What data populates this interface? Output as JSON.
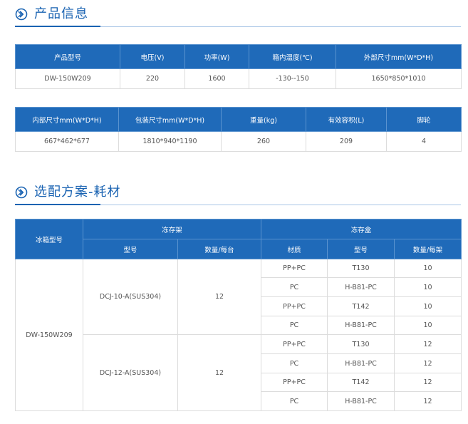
{
  "section1": {
    "title": "产品信息",
    "icon": "chevron-right-circle-icon",
    "table1": {
      "headers": [
        "产品型号",
        "电压(V)",
        "功率(W)",
        "箱内温度(℃)",
        "外部尺寸mm(W*D*H)"
      ],
      "row": [
        "DW-150W209",
        "220",
        "1600",
        "-130--150",
        "1650*850*1010"
      ]
    },
    "table2": {
      "headers": [
        "内部尺寸mm(W*D*H)",
        "包装尺寸mm(W*D*H)",
        "重量(kg)",
        "有效容积(L)",
        "脚轮"
      ],
      "row": [
        "667*462*677",
        "1810*940*1190",
        "260",
        "209",
        "4"
      ]
    }
  },
  "section2": {
    "title": "选配方案-耗材",
    "icon": "chevron-right-circle-icon",
    "table": {
      "model_header": "冰箱型号",
      "rack_group": "冻存架",
      "box_group": "冻存盒",
      "sub_headers": [
        "型号",
        "数量/每台",
        "材质",
        "型号",
        "数量/每架"
      ],
      "freezer_model": "DW-150W209",
      "racks": [
        {
          "model": "DCJ-10-A(SUS304)",
          "qty": "12",
          "boxes": [
            {
              "material": "PP+PC",
              "model": "T130",
              "qty": "10"
            },
            {
              "material": "PC",
              "model": "H-B81-PC",
              "qty": "10"
            },
            {
              "material": "PP+PC",
              "model": "T142",
              "qty": "10"
            },
            {
              "material": "PC",
              "model": "H-B81-PC",
              "qty": "10"
            }
          ]
        },
        {
          "model": "DCJ-12-A(SUS304)",
          "qty": "12",
          "boxes": [
            {
              "material": "PP+PC",
              "model": "T130",
              "qty": "12"
            },
            {
              "material": "PC",
              "model": "H-B81-PC",
              "qty": "12"
            },
            {
              "material": "PP+PC",
              "model": "T142",
              "qty": "12"
            },
            {
              "material": "PC",
              "model": "H-B81-PC",
              "qty": "12"
            }
          ]
        }
      ]
    }
  },
  "colors": {
    "accent": "#1a63b2",
    "header_bg": "#1f6ab9",
    "border": "#dcdcdc"
  }
}
